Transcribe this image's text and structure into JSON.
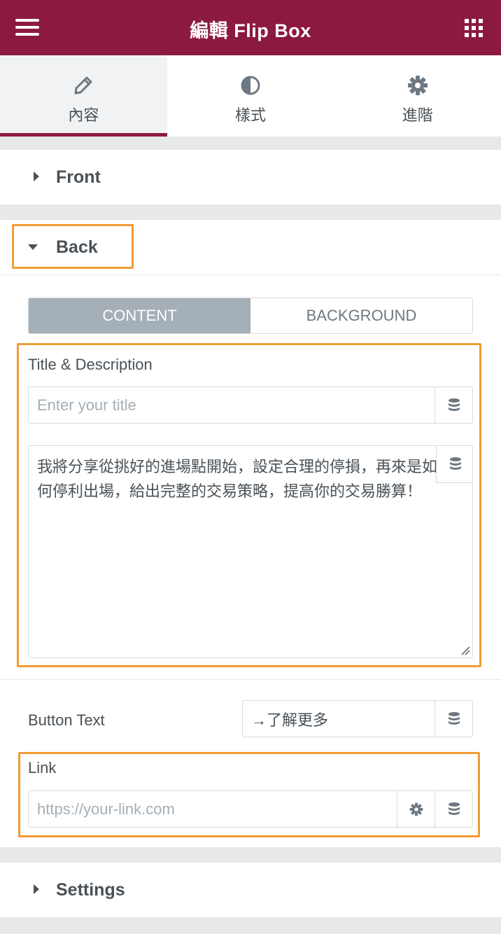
{
  "header": {
    "title": "編輯 Flip Box",
    "menu_icon": "hamburger-menu-icon",
    "apps_icon": "grid-apps-icon",
    "color": "#8c1a3e"
  },
  "tabs": [
    {
      "label": "內容",
      "icon": "pencil-icon",
      "active": true
    },
    {
      "label": "樣式",
      "icon": "half-circle-icon",
      "active": false
    },
    {
      "label": "進階",
      "icon": "gear-icon",
      "active": false
    }
  ],
  "sections": {
    "front": {
      "title": "Front"
    },
    "back": {
      "title": "Back"
    },
    "settings": {
      "title": "Settings"
    }
  },
  "switcher": {
    "content_label": "CONTENT",
    "background_label": "BACKGROUND",
    "active": "CONTENT"
  },
  "title_desc": {
    "label": "Title & Description",
    "title_value": "",
    "title_placeholder": "Enter your title",
    "description": "我將分享從挑好的進場點開始，設定合理的停損，再來是如何停利出場，給出完整的交易策略，提高你的交易勝算！"
  },
  "button_text": {
    "label": "Button Text",
    "value": "→了解更多"
  },
  "link": {
    "label": "Link",
    "value": "",
    "placeholder": "https://your-link.com"
  },
  "highlight_color": "#f19b34"
}
